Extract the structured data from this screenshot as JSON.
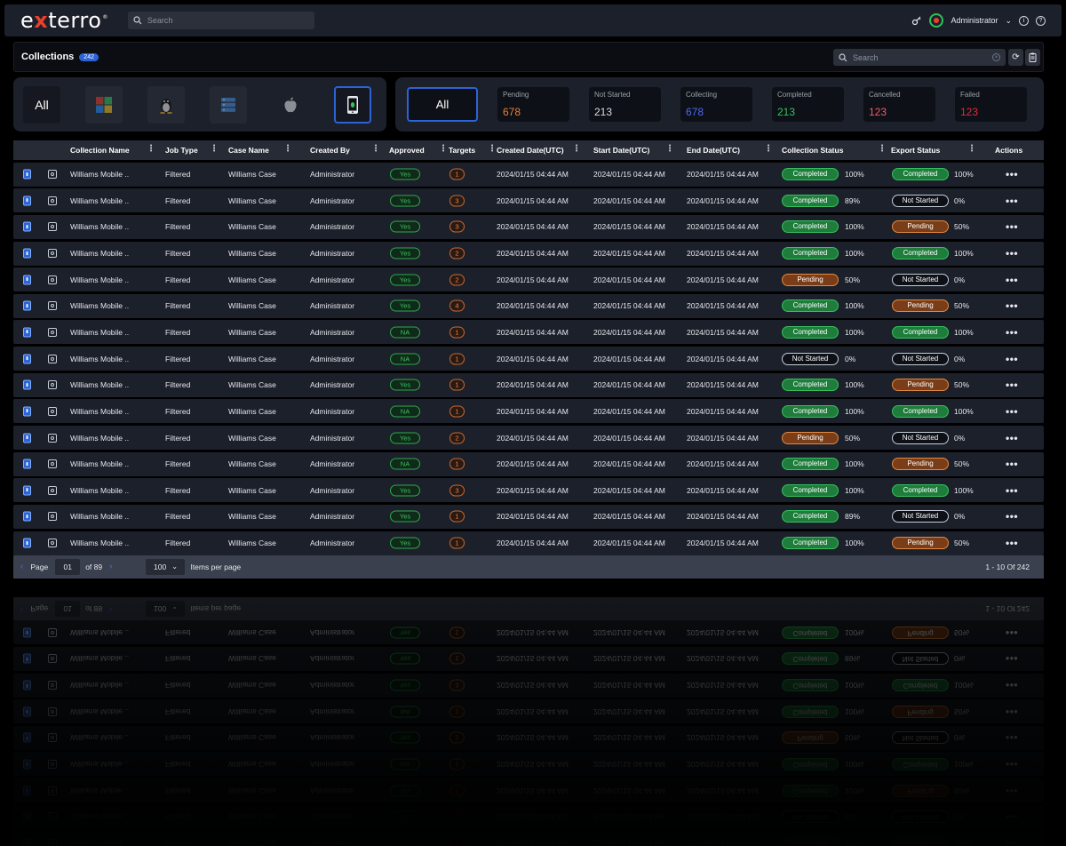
{
  "brand": {
    "logo_pre": "e",
    "logo_x": "x",
    "logo_post": "terro",
    "logo_mark": "®"
  },
  "topbar": {
    "search_placeholder": "Search",
    "user": "Administrator"
  },
  "collections": {
    "title": "Collections",
    "count": "242",
    "search_placeholder": "Search"
  },
  "platforms": {
    "all_label": "All",
    "icons": [
      "windows-icon",
      "linux-icon",
      "server-icon",
      "apple-icon",
      "mobile-icon"
    ],
    "selected": "mobile-icon"
  },
  "stats": {
    "all_label": "All",
    "items": [
      {
        "label": "Pending",
        "value": "678",
        "color": "#f07d2e"
      },
      {
        "label": "Not Started",
        "value": "213",
        "color": "#d8dbe2"
      },
      {
        "label": "Collecting",
        "value": "678",
        "color": "#4a6cf0"
      },
      {
        "label": "Completed",
        "value": "213",
        "color": "#37c060"
      },
      {
        "label": "Cancelled",
        "value": "123",
        "color": "#f05a6a"
      },
      {
        "label": "Failed",
        "value": "123",
        "color": "#e42a3a"
      }
    ]
  },
  "table": {
    "headers": [
      "Collection Name",
      "Job Type",
      "Case Name",
      "Created By",
      "Approved",
      "Targets",
      "Created Date(UTC)",
      "Start Date(UTC)",
      "End  Date(UTC)",
      "Collection Status",
      "Export Status",
      "Actions"
    ],
    "rows": [
      {
        "name": "Williams Mobile ..",
        "job": "Filtered",
        "case": "Williams Case",
        "by": "Administrator",
        "approved": "Yes",
        "targets": "1",
        "created": "2024/01/15 04:44 AM",
        "start": "2024/01/15 04:44 AM",
        "end": "2024/01/15 04:44 AM",
        "cstatus": "Completed",
        "cpct": "100%",
        "estatus": "Completed",
        "epct": "100%"
      },
      {
        "name": "Williams Mobile ..",
        "job": "Filtered",
        "case": "Williams Case",
        "by": "Administrator",
        "approved": "Yes",
        "targets": "3",
        "created": "2024/01/15 04:44 AM",
        "start": "2024/01/15 04:44 AM",
        "end": "2024/01/15 04:44 AM",
        "cstatus": "Completed",
        "cpct": "89%",
        "estatus": "Not Started",
        "epct": "0%"
      },
      {
        "name": "Williams Mobile ..",
        "job": "Filtered",
        "case": "Williams Case",
        "by": "Administrator",
        "approved": "Yes",
        "targets": "3",
        "created": "2024/01/15 04:44 AM",
        "start": "2024/01/15 04:44 AM",
        "end": "2024/01/15 04:44 AM",
        "cstatus": "Completed",
        "cpct": "100%",
        "estatus": "Pending",
        "epct": "50%"
      },
      {
        "name": "Williams Mobile ..",
        "job": "Filtered",
        "case": "Williams Case",
        "by": "Administrator",
        "approved": "Yes",
        "targets": "2",
        "created": "2024/01/15 04:44 AM",
        "start": "2024/01/15 04:44 AM",
        "end": "2024/01/15 04:44 AM",
        "cstatus": "Completed",
        "cpct": "100%",
        "estatus": "Completed",
        "epct": "100%"
      },
      {
        "name": "Williams Mobile ..",
        "job": "Filtered",
        "case": "Williams Case",
        "by": "Administrator",
        "approved": "Yes",
        "targets": "2",
        "created": "2024/01/15 04:44 AM",
        "start": "2024/01/15 04:44 AM",
        "end": "2024/01/15 04:44 AM",
        "cstatus": "Pending",
        "cpct": "50%",
        "estatus": "Not Started",
        "epct": "0%"
      },
      {
        "name": "Williams Mobile ..",
        "job": "Filtered",
        "case": "Williams Case",
        "by": "Administrator",
        "approved": "Yes",
        "targets": "4",
        "created": "2024/01/15 04:44 AM",
        "start": "2024/01/15 04:44 AM",
        "end": "2024/01/15 04:44 AM",
        "cstatus": "Completed",
        "cpct": "100%",
        "estatus": "Pending",
        "epct": "50%"
      },
      {
        "name": "Williams Mobile ..",
        "job": "Filtered",
        "case": "Williams Case",
        "by": "Administrator",
        "approved": "NA",
        "targets": "1",
        "created": "2024/01/15 04:44 AM",
        "start": "2024/01/15 04:44 AM",
        "end": "2024/01/15 04:44 AM",
        "cstatus": "Completed",
        "cpct": "100%",
        "estatus": "Completed",
        "epct": "100%"
      },
      {
        "name": "Williams Mobile ..",
        "job": "Filtered",
        "case": "Williams Case",
        "by": "Administrator",
        "approved": "NA",
        "targets": "1",
        "created": "2024/01/15 04:44 AM",
        "start": "2024/01/15 04:44 AM",
        "end": "2024/01/15 04:44 AM",
        "cstatus": "Not Started",
        "cpct": "0%",
        "estatus": "Not Started",
        "epct": "0%"
      },
      {
        "name": "Williams Mobile ..",
        "job": "Filtered",
        "case": "Williams Case",
        "by": "Administrator",
        "approved": "Yes",
        "targets": "1",
        "created": "2024/01/15 04:44 AM",
        "start": "2024/01/15 04:44 AM",
        "end": "2024/01/15 04:44 AM",
        "cstatus": "Completed",
        "cpct": "100%",
        "estatus": "Pending",
        "epct": "50%"
      },
      {
        "name": "Williams Mobile ..",
        "job": "Filtered",
        "case": "Williams Case",
        "by": "Administrator",
        "approved": "NA",
        "targets": "1",
        "created": "2024/01/15 04:44 AM",
        "start": "2024/01/15 04:44 AM",
        "end": "2024/01/15 04:44 AM",
        "cstatus": "Completed",
        "cpct": "100%",
        "estatus": "Completed",
        "epct": "100%"
      },
      {
        "name": "Williams Mobile ..",
        "job": "Filtered",
        "case": "Williams Case",
        "by": "Administrator",
        "approved": "Yes",
        "targets": "2",
        "created": "2024/01/15 04:44 AM",
        "start": "2024/01/15 04:44 AM",
        "end": "2024/01/15 04:44 AM",
        "cstatus": "Pending",
        "cpct": "50%",
        "estatus": "Not Started",
        "epct": "0%"
      },
      {
        "name": "Williams Mobile ..",
        "job": "Filtered",
        "case": "Williams Case",
        "by": "Administrator",
        "approved": "NA",
        "targets": "1",
        "created": "2024/01/15 04:44 AM",
        "start": "2024/01/15 04:44 AM",
        "end": "2024/01/15 04:44 AM",
        "cstatus": "Completed",
        "cpct": "100%",
        "estatus": "Pending",
        "epct": "50%"
      },
      {
        "name": "Williams Mobile ..",
        "job": "Filtered",
        "case": "Williams Case",
        "by": "Administrator",
        "approved": "Yes",
        "targets": "3",
        "created": "2024/01/15 04:44 AM",
        "start": "2024/01/15 04:44 AM",
        "end": "2024/01/15 04:44 AM",
        "cstatus": "Completed",
        "cpct": "100%",
        "estatus": "Completed",
        "epct": "100%"
      },
      {
        "name": "Williams Mobile ..",
        "job": "Filtered",
        "case": "Williams Case",
        "by": "Administrator",
        "approved": "Yes",
        "targets": "1",
        "created": "2024/01/15 04:44 AM",
        "start": "2024/01/15 04:44 AM",
        "end": "2024/01/15 04:44 AM",
        "cstatus": "Completed",
        "cpct": "89%",
        "estatus": "Not Started",
        "epct": "0%"
      },
      {
        "name": "Williams Mobile ..",
        "job": "Filtered",
        "case": "Williams Case",
        "by": "Administrator",
        "approved": "Yes",
        "targets": "1",
        "created": "2024/01/15 04:44 AM",
        "start": "2024/01/15 04:44 AM",
        "end": "2024/01/15 04:44 AM",
        "cstatus": "Completed",
        "cpct": "100%",
        "estatus": "Pending",
        "epct": "50%"
      }
    ],
    "actions_glyph": "•••"
  },
  "pager": {
    "page_label": "Page",
    "page": "01",
    "of_label": "of 89",
    "per_page": "100",
    "per_page_label": "Items per page",
    "range": "1 - 10 Of 242"
  }
}
